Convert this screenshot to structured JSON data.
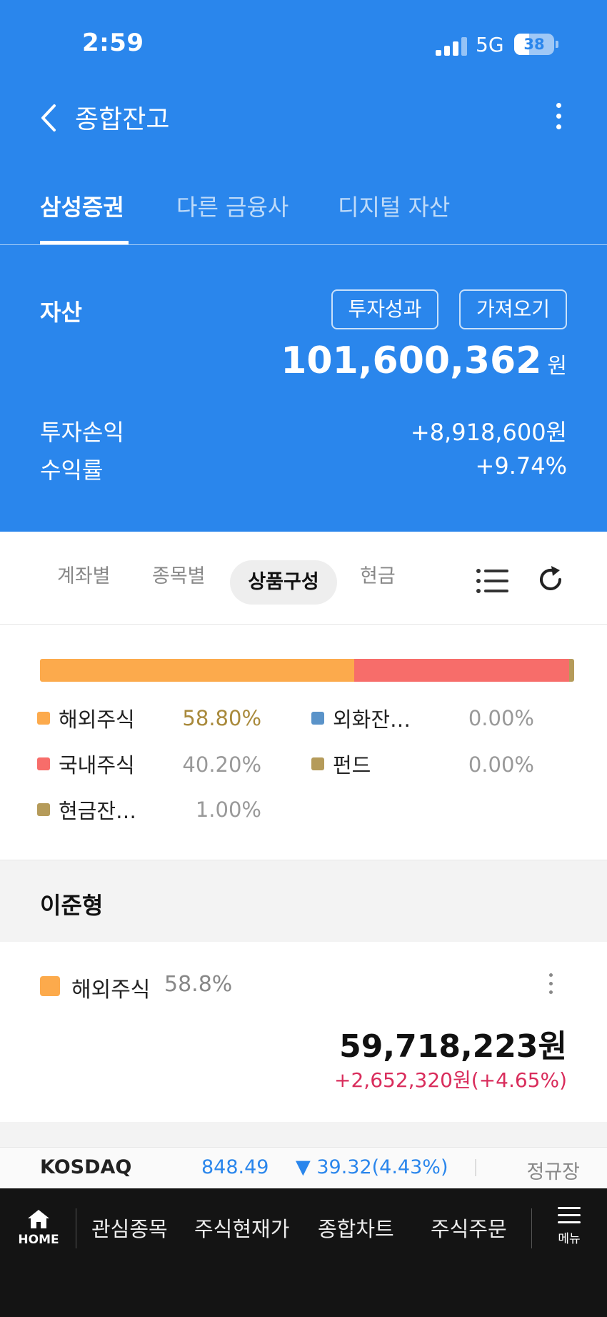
{
  "status_bar": {
    "time": "2:59",
    "network": "5G",
    "battery": "38"
  },
  "nav": {
    "title": "종합잔고"
  },
  "tabs": [
    {
      "label": "삼성증권",
      "active": true
    },
    {
      "label": "다른 금융사",
      "active": false
    },
    {
      "label": "디지털 자산",
      "active": false
    }
  ],
  "summary": {
    "asset_label": "자산",
    "btn_performance": "투자성과",
    "btn_import": "가져오기",
    "total": "101,600,362",
    "total_unit": "원",
    "pnl_label": "투자손익",
    "pnl_value": "+8,918,600원",
    "return_label": "수익률",
    "return_value": "+9.74%"
  },
  "segments": [
    {
      "label": "계좌별",
      "active": false
    },
    {
      "label": "종목별",
      "active": false
    },
    {
      "label": "상품구성",
      "active": true
    },
    {
      "label": "현금",
      "active": false
    }
  ],
  "composition": {
    "bar": [
      {
        "name": "해외주식",
        "share": 58.8,
        "color": "#fcaa4c"
      },
      {
        "name": "국내주식",
        "share": 40.2,
        "color": "#f76d6a"
      },
      {
        "name": "현금잔…",
        "share": 1.0,
        "color": "#b59b5a"
      }
    ],
    "legend": [
      {
        "label": "해외주식",
        "value": "58.80%",
        "color": "#fcaa4c",
        "value_color": "#a98a3c"
      },
      {
        "label": "외화잔…",
        "value": "0.00%",
        "color": "#5a93c9",
        "value_color": "#999999"
      },
      {
        "label": "국내주식",
        "value": "40.20%",
        "color": "#f76d6a",
        "value_color": "#999999"
      },
      {
        "label": "펀드",
        "value": "0.00%",
        "color": "#b59b5a",
        "value_color": "#999999"
      },
      {
        "label": "현금잔…",
        "value": "1.00%",
        "color": "#b59b5a",
        "value_color": "#999999"
      }
    ]
  },
  "owner": {
    "name": "이준형"
  },
  "holding": {
    "name": "해외주식",
    "share": "58.8%",
    "amount": "59,718,223원",
    "change": "+2,652,320원(+4.65%)"
  },
  "ticker": {
    "index": "KOSDAQ",
    "value": "848.49",
    "change": "▼ 39.32(4.43%)",
    "session": "정규장"
  },
  "bottom_nav": {
    "home": "HOME",
    "items": [
      "관심종목",
      "주식현재가",
      "종합차트",
      "주식주문"
    ],
    "menu": "메뉴"
  }
}
